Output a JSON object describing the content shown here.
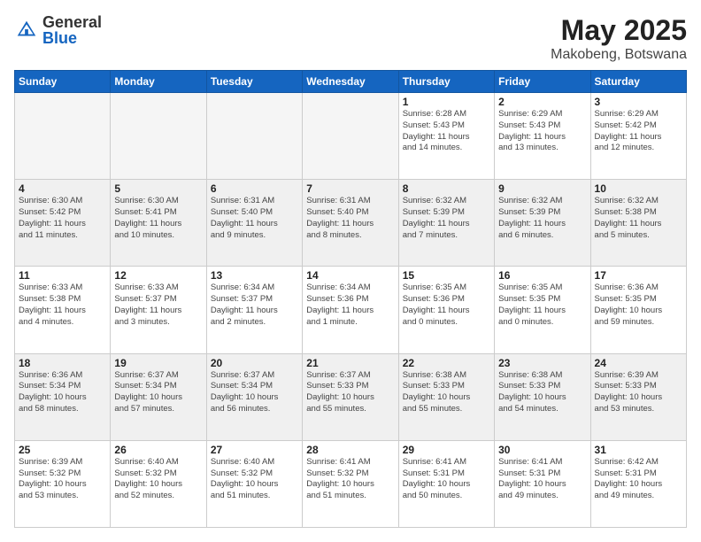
{
  "header": {
    "logo_general": "General",
    "logo_blue": "Blue",
    "title": "May 2025",
    "subtitle": "Makobeng, Botswana"
  },
  "weekdays": [
    "Sunday",
    "Monday",
    "Tuesday",
    "Wednesday",
    "Thursday",
    "Friday",
    "Saturday"
  ],
  "weeks": [
    [
      {
        "day": "",
        "info": "",
        "empty": true
      },
      {
        "day": "",
        "info": "",
        "empty": true
      },
      {
        "day": "",
        "info": "",
        "empty": true
      },
      {
        "day": "",
        "info": "",
        "empty": true
      },
      {
        "day": "1",
        "info": "Sunrise: 6:28 AM\nSunset: 5:43 PM\nDaylight: 11 hours\nand 14 minutes.",
        "empty": false
      },
      {
        "day": "2",
        "info": "Sunrise: 6:29 AM\nSunset: 5:43 PM\nDaylight: 11 hours\nand 13 minutes.",
        "empty": false
      },
      {
        "day": "3",
        "info": "Sunrise: 6:29 AM\nSunset: 5:42 PM\nDaylight: 11 hours\nand 12 minutes.",
        "empty": false
      }
    ],
    [
      {
        "day": "4",
        "info": "Sunrise: 6:30 AM\nSunset: 5:42 PM\nDaylight: 11 hours\nand 11 minutes.",
        "empty": false
      },
      {
        "day": "5",
        "info": "Sunrise: 6:30 AM\nSunset: 5:41 PM\nDaylight: 11 hours\nand 10 minutes.",
        "empty": false
      },
      {
        "day": "6",
        "info": "Sunrise: 6:31 AM\nSunset: 5:40 PM\nDaylight: 11 hours\nand 9 minutes.",
        "empty": false
      },
      {
        "day": "7",
        "info": "Sunrise: 6:31 AM\nSunset: 5:40 PM\nDaylight: 11 hours\nand 8 minutes.",
        "empty": false
      },
      {
        "day": "8",
        "info": "Sunrise: 6:32 AM\nSunset: 5:39 PM\nDaylight: 11 hours\nand 7 minutes.",
        "empty": false
      },
      {
        "day": "9",
        "info": "Sunrise: 6:32 AM\nSunset: 5:39 PM\nDaylight: 11 hours\nand 6 minutes.",
        "empty": false
      },
      {
        "day": "10",
        "info": "Sunrise: 6:32 AM\nSunset: 5:38 PM\nDaylight: 11 hours\nand 5 minutes.",
        "empty": false
      }
    ],
    [
      {
        "day": "11",
        "info": "Sunrise: 6:33 AM\nSunset: 5:38 PM\nDaylight: 11 hours\nand 4 minutes.",
        "empty": false
      },
      {
        "day": "12",
        "info": "Sunrise: 6:33 AM\nSunset: 5:37 PM\nDaylight: 11 hours\nand 3 minutes.",
        "empty": false
      },
      {
        "day": "13",
        "info": "Sunrise: 6:34 AM\nSunset: 5:37 PM\nDaylight: 11 hours\nand 2 minutes.",
        "empty": false
      },
      {
        "day": "14",
        "info": "Sunrise: 6:34 AM\nSunset: 5:36 PM\nDaylight: 11 hours\nand 1 minute.",
        "empty": false
      },
      {
        "day": "15",
        "info": "Sunrise: 6:35 AM\nSunset: 5:36 PM\nDaylight: 11 hours\nand 0 minutes.",
        "empty": false
      },
      {
        "day": "16",
        "info": "Sunrise: 6:35 AM\nSunset: 5:35 PM\nDaylight: 11 hours\nand 0 minutes.",
        "empty": false
      },
      {
        "day": "17",
        "info": "Sunrise: 6:36 AM\nSunset: 5:35 PM\nDaylight: 10 hours\nand 59 minutes.",
        "empty": false
      }
    ],
    [
      {
        "day": "18",
        "info": "Sunrise: 6:36 AM\nSunset: 5:34 PM\nDaylight: 10 hours\nand 58 minutes.",
        "empty": false
      },
      {
        "day": "19",
        "info": "Sunrise: 6:37 AM\nSunset: 5:34 PM\nDaylight: 10 hours\nand 57 minutes.",
        "empty": false
      },
      {
        "day": "20",
        "info": "Sunrise: 6:37 AM\nSunset: 5:34 PM\nDaylight: 10 hours\nand 56 minutes.",
        "empty": false
      },
      {
        "day": "21",
        "info": "Sunrise: 6:37 AM\nSunset: 5:33 PM\nDaylight: 10 hours\nand 55 minutes.",
        "empty": false
      },
      {
        "day": "22",
        "info": "Sunrise: 6:38 AM\nSunset: 5:33 PM\nDaylight: 10 hours\nand 55 minutes.",
        "empty": false
      },
      {
        "day": "23",
        "info": "Sunrise: 6:38 AM\nSunset: 5:33 PM\nDaylight: 10 hours\nand 54 minutes.",
        "empty": false
      },
      {
        "day": "24",
        "info": "Sunrise: 6:39 AM\nSunset: 5:33 PM\nDaylight: 10 hours\nand 53 minutes.",
        "empty": false
      }
    ],
    [
      {
        "day": "25",
        "info": "Sunrise: 6:39 AM\nSunset: 5:32 PM\nDaylight: 10 hours\nand 53 minutes.",
        "empty": false
      },
      {
        "day": "26",
        "info": "Sunrise: 6:40 AM\nSunset: 5:32 PM\nDaylight: 10 hours\nand 52 minutes.",
        "empty": false
      },
      {
        "day": "27",
        "info": "Sunrise: 6:40 AM\nSunset: 5:32 PM\nDaylight: 10 hours\nand 51 minutes.",
        "empty": false
      },
      {
        "day": "28",
        "info": "Sunrise: 6:41 AM\nSunset: 5:32 PM\nDaylight: 10 hours\nand 51 minutes.",
        "empty": false
      },
      {
        "day": "29",
        "info": "Sunrise: 6:41 AM\nSunset: 5:31 PM\nDaylight: 10 hours\nand 50 minutes.",
        "empty": false
      },
      {
        "day": "30",
        "info": "Sunrise: 6:41 AM\nSunset: 5:31 PM\nDaylight: 10 hours\nand 49 minutes.",
        "empty": false
      },
      {
        "day": "31",
        "info": "Sunrise: 6:42 AM\nSunset: 5:31 PM\nDaylight: 10 hours\nand 49 minutes.",
        "empty": false
      }
    ]
  ]
}
